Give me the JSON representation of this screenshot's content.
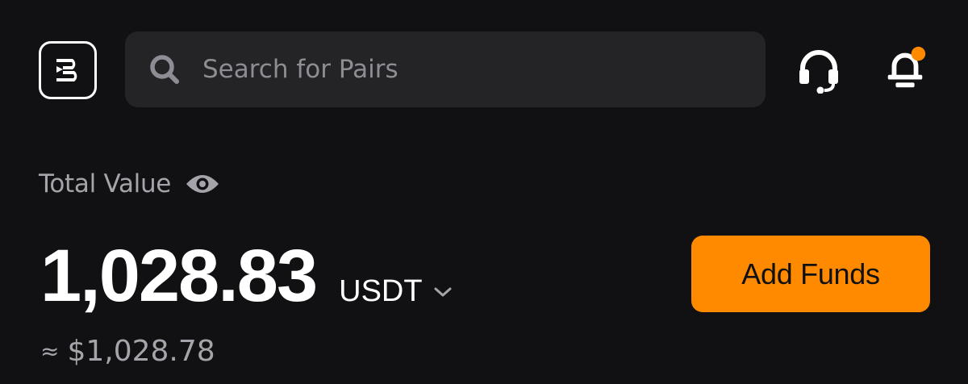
{
  "header": {
    "logo_icon": "brand-logo-icon",
    "search": {
      "placeholder": "Search for Pairs",
      "value": "",
      "icon": "search-icon"
    },
    "support_icon": "headset-icon",
    "notification_icon": "bell-icon",
    "notification_dot_color": "#ff8a00"
  },
  "balance": {
    "label": "Total Value",
    "visibility_icon": "eye-icon",
    "amount": "1,028.83",
    "currency": "USDT",
    "currency_dropdown_icon": "chevron-down-icon",
    "approx_sign": "≈",
    "approx_value": "$1,028.78"
  },
  "actions": {
    "add_funds_label": "Add Funds"
  },
  "colors": {
    "background": "#111113",
    "surface": "#242427",
    "accent": "#ff8a00",
    "muted_text": "#a4a4aa",
    "placeholder_text": "#8d8d93"
  }
}
